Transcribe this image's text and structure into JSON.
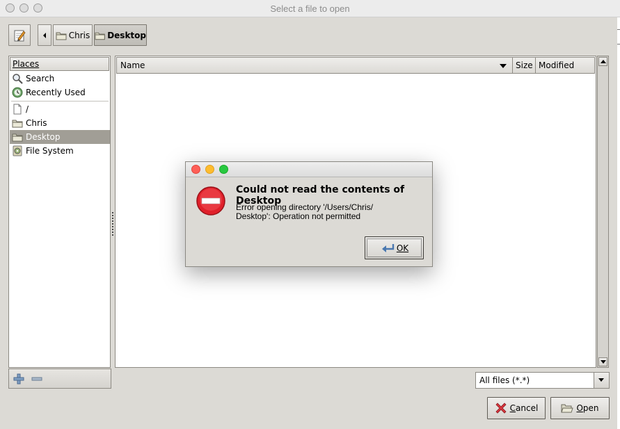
{
  "window": {
    "title": "Select a file to open"
  },
  "path_bar": {
    "segments": [
      {
        "label": "Chris"
      },
      {
        "label": "Desktop",
        "active": true
      }
    ]
  },
  "places": {
    "header": "Places",
    "items": [
      {
        "label": "Search",
        "icon": "search-icon"
      },
      {
        "label": "Recently Used",
        "icon": "recent-icon"
      },
      {
        "label": "/",
        "icon": "file-icon"
      },
      {
        "label": "Chris",
        "icon": "folder-icon"
      },
      {
        "label": "Desktop",
        "icon": "folder-icon",
        "selected": true
      },
      {
        "label": "File System",
        "icon": "drive-icon"
      }
    ]
  },
  "file_list": {
    "columns": [
      "Name",
      "Size",
      "Modified"
    ],
    "rows": []
  },
  "filter": {
    "selected": "All files (*.*)"
  },
  "actions": {
    "cancel_label": "Cancel",
    "open_label": "Open"
  },
  "error_dialog": {
    "title": "Could not read the contents of Desktop",
    "message_line1": "Error opening directory '/Users/Chris/",
    "message_line2": "Desktop': Operation not permitted",
    "ok_label": "OK"
  },
  "colors": {
    "window_bg": "#dcdad5",
    "selection_bg": "#a19e96",
    "error_red": "#e0202a",
    "mac_close": "#fe5f57",
    "mac_minimize": "#febc2e",
    "mac_zoom": "#28c840"
  }
}
